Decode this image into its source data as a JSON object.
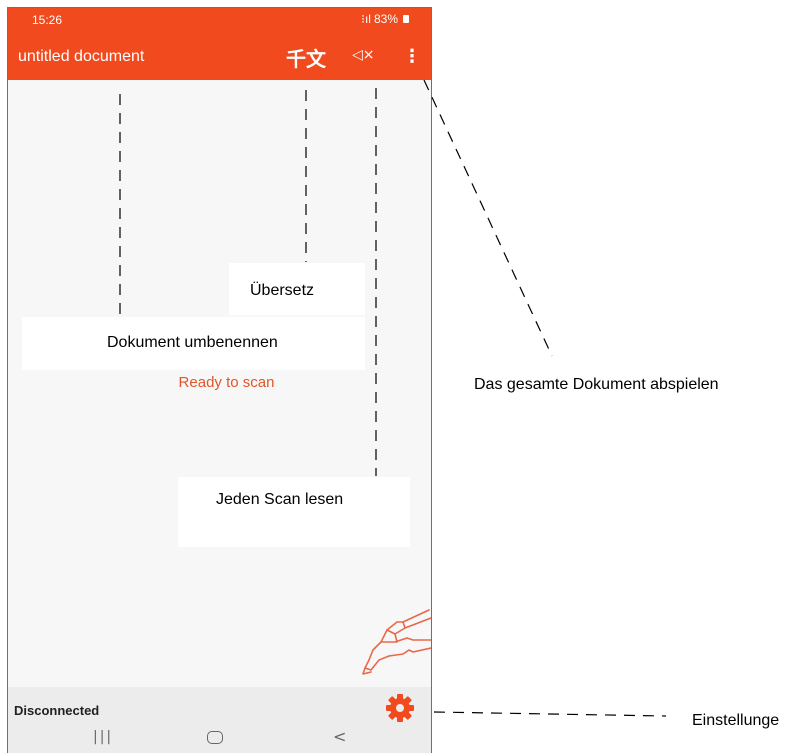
{
  "status_bar": {
    "time": "15:26",
    "signal_icons": "⁝ıl",
    "battery": "83%"
  },
  "app_bar": {
    "title": "untitled document",
    "translate_icon": "千文",
    "mute_icon": "◁×",
    "more_icon": "⋮"
  },
  "main": {
    "ready_text": "Ready to scan"
  },
  "bottom": {
    "connection_status": "Disconnected"
  },
  "navigation": {
    "recent": "|||",
    "back": "<"
  },
  "annotations": {
    "rename": "Dokument umbenennen",
    "translate": "Übersetz",
    "read_each_scan": "Jeden Scan lesen",
    "play_document": "Das gesamte Dokument abspielen",
    "settings": "Einstellunge"
  },
  "colors": {
    "accent": "#f04a1e",
    "ready_text": "#e0552a",
    "phone_border": "#4a73c4"
  }
}
